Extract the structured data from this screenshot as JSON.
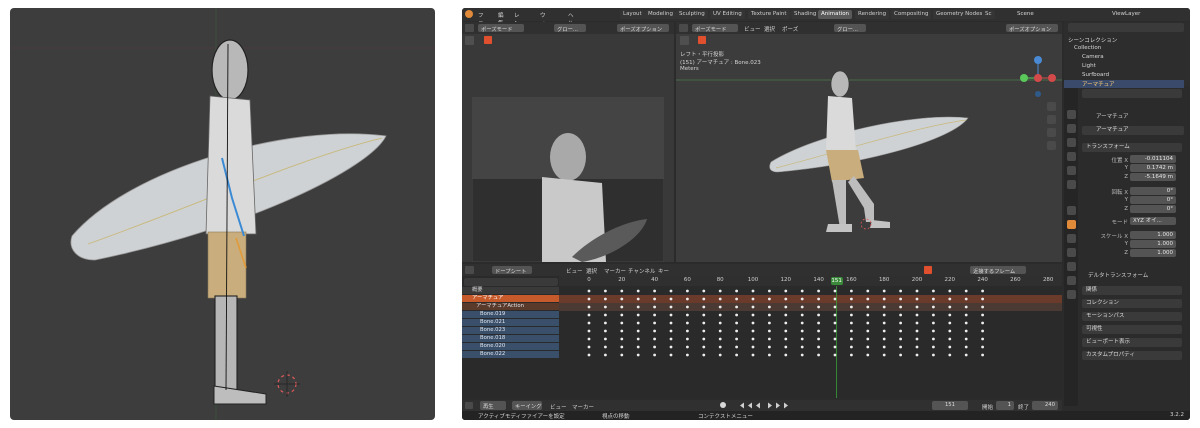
{
  "left_viewport": {
    "description_icon": "3d-cursor-icon"
  },
  "topbar": {
    "menus": [
      "ファイル",
      "編集",
      "レンダー",
      "ウィンドウ",
      "ヘルプ"
    ],
    "workspaces": [
      "Layout",
      "Modeling",
      "Sculpting",
      "UV Editing",
      "Texture Paint",
      "Shading",
      "Animation",
      "Rendering",
      "Compositing",
      "Geometry Nodes",
      "Sc"
    ],
    "active_workspace": "Animation",
    "scene": "Scene",
    "view_layer": "ViewLayer"
  },
  "camera_view_header": {
    "mode": "ポーズモード",
    "pivot": "グロー...",
    "options": "ポーズオプション"
  },
  "main_view_header": {
    "mode": "ポーズモード",
    "menus": [
      "ビュー",
      "選択",
      "ポーズ"
    ],
    "pivot": "グロー...",
    "options": "ポーズオプション"
  },
  "viewport_overlay": {
    "line1": "レフト・平行投影",
    "line2": "(151) アーマチュア : Bone.023",
    "line3": "Meters"
  },
  "outliner": {
    "title": "シーンコレクション",
    "items": [
      "Collection",
      "Camera",
      "Light",
      "Surfboard",
      "アーマチュア"
    ]
  },
  "properties": {
    "object_name": "アーマチュア",
    "field_name": "アーマチュア",
    "section_transform": "トランスフォーム",
    "location_label": "位置 X",
    "location": [
      "-0.011104",
      "0.1742 m",
      "-5.1649 m"
    ],
    "rotation_label": "回転 X",
    "rotation": [
      "0°",
      "0°",
      "0°"
    ],
    "mode_label": "モード",
    "mode_value": "XYZ オイ...",
    "scale_label": "スケール X",
    "scale": [
      "1.000",
      "1.000",
      "1.000"
    ],
    "axis_y": "Y",
    "axis_z": "Z",
    "delta": "デルタトランスフォーム",
    "panels": [
      "関係",
      "コレクション",
      "モーションパス",
      "可視性",
      "ビューポート表示",
      "カスタムプロパティ"
    ]
  },
  "dopesheet": {
    "editor": "ドープシート",
    "menus": [
      "ビュー",
      "選択",
      "マーカー",
      "チャンネル",
      "キー"
    ],
    "interpolation": "近接するフレーム",
    "ticks": [
      "0",
      "20",
      "40",
      "60",
      "80",
      "100",
      "120",
      "140",
      "160",
      "180",
      "200",
      "220",
      "240",
      "260",
      "280"
    ],
    "current_frame_badge": "151",
    "summary": "概要",
    "armature": "アーマチュア",
    "action": "アーマチュアAction",
    "bones": [
      "Bone.019",
      "Bone.021",
      "Bone.023",
      "Bone.018",
      "Bone.020",
      "Bone.022"
    ],
    "key_frames": [
      0,
      10,
      20,
      30,
      40,
      50,
      60,
      70,
      80,
      90,
      100,
      110,
      120,
      130,
      140,
      150,
      160,
      170,
      180,
      190,
      200,
      210,
      220,
      230,
      240
    ]
  },
  "playback": {
    "playback": "再生",
    "keying": "キーイング",
    "view": "ビュー",
    "marker": "マーカー",
    "current_frame": "151",
    "start_label": "開始",
    "start": "1",
    "end_label": "終了",
    "end": "240"
  },
  "status_bar": {
    "item1": "アクティブモディファイアーを設定",
    "item2": "視点の移動",
    "item3": "コンテクストメニュー",
    "version": "3.2.2"
  }
}
